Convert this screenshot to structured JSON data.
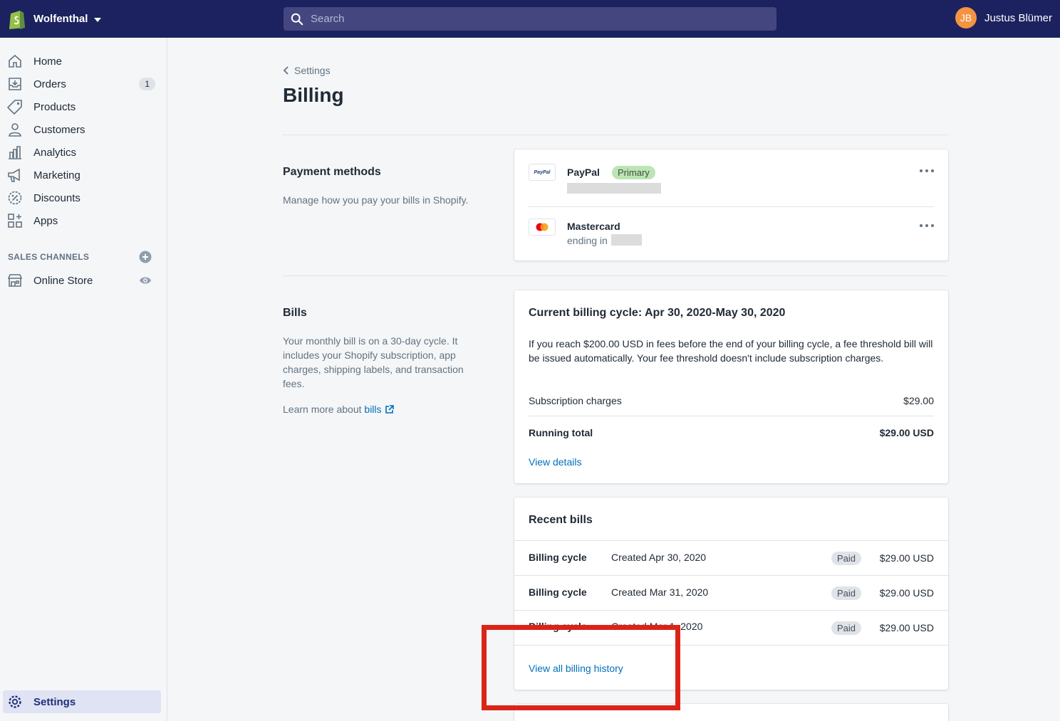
{
  "topbar": {
    "store_name": "Wolfenthal",
    "search_placeholder": "Search",
    "user_initials": "JB",
    "user_name": "Justus Blümer"
  },
  "sidebar": {
    "items": [
      {
        "label": "Home",
        "icon": "home-icon"
      },
      {
        "label": "Orders",
        "icon": "orders-icon",
        "badge": "1"
      },
      {
        "label": "Products",
        "icon": "tag-icon"
      },
      {
        "label": "Customers",
        "icon": "person-icon"
      },
      {
        "label": "Analytics",
        "icon": "bar-chart-icon"
      },
      {
        "label": "Marketing",
        "icon": "megaphone-icon"
      },
      {
        "label": "Discounts",
        "icon": "discount-icon"
      },
      {
        "label": "Apps",
        "icon": "apps-icon"
      }
    ],
    "sales_channels_title": "SALES CHANNELS",
    "online_store": "Online Store",
    "settings": "Settings"
  },
  "page": {
    "breadcrumb": "Settings",
    "title": "Billing"
  },
  "payment_methods": {
    "title": "Payment methods",
    "description": "Manage how you pay your bills in Shopify.",
    "methods": [
      {
        "name": "PayPal",
        "badge": "Primary",
        "icon": "paypal-icon"
      },
      {
        "name": "Mastercard",
        "sub": "ending in",
        "icon": "mastercard-icon"
      }
    ],
    "paypal_logo_text": "PayPal"
  },
  "bills": {
    "title": "Bills",
    "description": "Your monthly bill is on a 30-day cycle. It includes your Shopify subscription, app charges, shipping labels, and transaction fees.",
    "learn_more_prefix": "Learn more about ",
    "learn_more_link": "bills",
    "current": {
      "heading": "Current billing cycle: Apr 30, 2020-May 30, 2020",
      "notice": "If you reach $200.00 USD in fees before the end of your billing cycle, a fee threshold bill will be issued automatically. Your fee threshold doesn't include subscription charges.",
      "subscription_label": "Subscription charges",
      "subscription_value": "$29.00",
      "running_total_label": "Running total",
      "running_total_value": "$29.00 USD",
      "view_details": "View details"
    },
    "recent": {
      "heading": "Recent bills",
      "rows": [
        {
          "type": "Billing cycle",
          "date": "Created Apr 30, 2020",
          "status": "Paid",
          "amount": "$29.00 USD"
        },
        {
          "type": "Billing cycle",
          "date": "Created Mar 31, 2020",
          "status": "Paid",
          "amount": "$29.00 USD"
        },
        {
          "type": "Billing cycle",
          "date": "Created Mar 1, 2020",
          "status": "Paid",
          "amount": "$29.00 USD"
        }
      ],
      "view_all": "View all billing history"
    }
  },
  "colors": {
    "topbar": "#1c2260",
    "link": "#006fbb",
    "annotation": "#db2419"
  }
}
